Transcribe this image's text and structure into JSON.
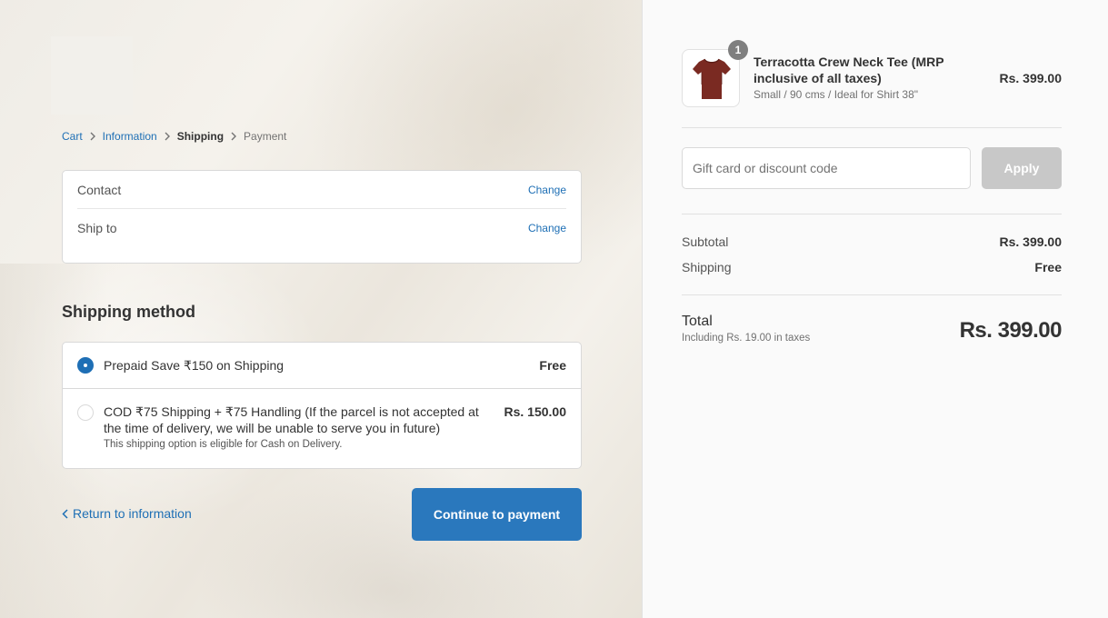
{
  "breadcrumb": {
    "items": [
      {
        "label": "Cart",
        "state": "link"
      },
      {
        "label": "Information",
        "state": "link"
      },
      {
        "label": "Shipping",
        "state": "current"
      },
      {
        "label": "Payment",
        "state": "upcoming"
      }
    ]
  },
  "review": {
    "contact_label": "Contact",
    "ship_to_label": "Ship to",
    "change_label": "Change"
  },
  "shipping": {
    "title": "Shipping method",
    "methods": [
      {
        "label": "Prepaid Save ₹150 on Shipping",
        "price": "Free",
        "selected": true
      },
      {
        "label": "COD ₹75 Shipping + ₹75 Handling (If the parcel is not accepted at the time of delivery, we will be unable to serve you in future)",
        "price": "Rs. 150.00",
        "note": "This shipping option is eligible for Cash on Delivery.",
        "selected": false
      }
    ]
  },
  "footer_actions": {
    "return_label": "Return to information",
    "continue_label": "Continue to payment"
  },
  "order": {
    "product": {
      "name": "Terracotta Crew Neck Tee (MRP inclusive of all taxes)",
      "variant": "Small / 90 cms / Ideal for Shirt 38\"",
      "price": "Rs. 399.00",
      "quantity": "1",
      "image_icon": "t-shirt-icon",
      "color": "#7a2a22"
    },
    "discount": {
      "placeholder": "Gift card or discount code",
      "apply_label": "Apply"
    },
    "subtotal_label": "Subtotal",
    "subtotal_value": "Rs. 399.00",
    "shipping_label": "Shipping",
    "shipping_value": "Free",
    "total_label": "Total",
    "tax_note": "Including Rs. 19.00 in taxes",
    "total_value": "Rs. 399.00"
  },
  "colors": {
    "accent": "#2a78bd",
    "link": "#1e6fb5",
    "apply_disabled": "#c8c8c8"
  }
}
